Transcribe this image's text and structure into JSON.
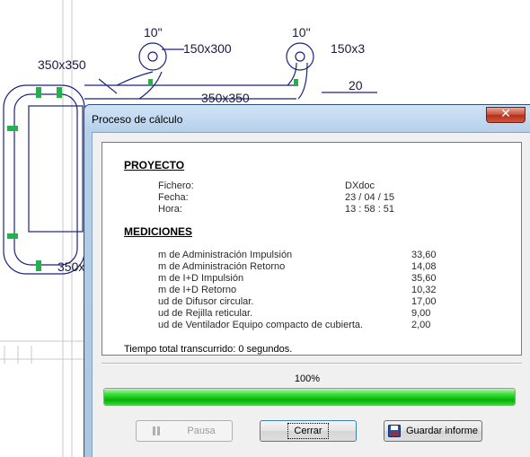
{
  "background": {
    "duct_labels": [
      "10\"",
      "10\"",
      "150x300",
      "150x3",
      "350x350",
      "350x350",
      "20",
      "350x"
    ]
  },
  "dialog": {
    "title": "Proceso de cálculo",
    "close_symbol": "✕",
    "report": {
      "project_heading": "PROYECTO",
      "project_fields": [
        {
          "label": "Fichero:",
          "value": "DXdoc"
        },
        {
          "label": "Fecha:",
          "value": "23 / 04 / 15"
        },
        {
          "label": "Hora:",
          "value": "13 : 58 : 51"
        }
      ],
      "measurements_heading": "MEDICIONES",
      "measurements": [
        {
          "label": "m de Administración Impulsión",
          "value": "33,60"
        },
        {
          "label": "m de Administración Retorno",
          "value": "14,08"
        },
        {
          "label": "m de I+D Impulsión",
          "value": "35,60"
        },
        {
          "label": "m de I+D Retorno",
          "value": "10,32"
        },
        {
          "label": "ud de Difusor circular.",
          "value": "17,00"
        },
        {
          "label": "ud de Rejilla reticular.",
          "value": "9,00"
        },
        {
          "label": "ud de Ventilador Equipo compacto de cubierta.",
          "value": "2,00"
        }
      ],
      "elapsed": "Tiempo total transcurrido: 0 segundos."
    },
    "progress": {
      "percent_text": "100%",
      "fraction": 1.0
    },
    "buttons": {
      "pause": "Pausa",
      "close": "Cerrar",
      "save": "Guardar informe"
    },
    "colors": {
      "progress": "#06b006",
      "title_bar": "#b6d0ea",
      "close_button": "#c74b35"
    }
  }
}
